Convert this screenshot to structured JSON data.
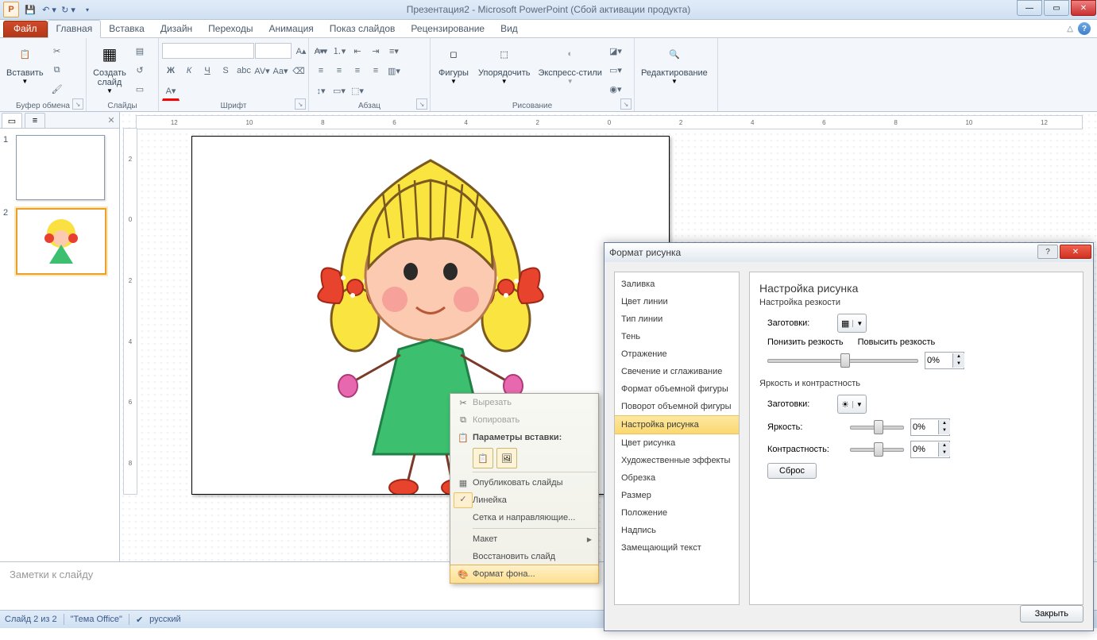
{
  "title": "Презентация2  -  Microsoft PowerPoint (Сбой активации продукта)",
  "tabs": {
    "file": "Файл",
    "list": [
      "Главная",
      "Вставка",
      "Дизайн",
      "Переходы",
      "Анимация",
      "Показ слайдов",
      "Рецензирование",
      "Вид"
    ]
  },
  "groups": {
    "clipboard": {
      "paste": "Вставить",
      "label": "Буфер обмена"
    },
    "slides": {
      "new": "Создать\nслайд",
      "label": "Слайды"
    },
    "font": {
      "label": "Шрифт"
    },
    "para": {
      "label": "Абзац"
    },
    "draw": {
      "shapes": "Фигуры",
      "arrange": "Упорядочить",
      "styles": "Экспресс-стили",
      "label": "Рисование"
    },
    "edit": {
      "btn": "Редактирование"
    }
  },
  "thumbs": [
    "1",
    "2"
  ],
  "ruler": [
    "12",
    "10",
    "8",
    "6",
    "4",
    "2",
    "0",
    "2",
    "4",
    "6",
    "8",
    "10",
    "12"
  ],
  "rulerV": [
    "2",
    "0",
    "2",
    "4",
    "6",
    "8"
  ],
  "notes": "Заметки к слайду",
  "status": {
    "slide": "Слайд 2 из 2",
    "theme": "\"Тема Office\"",
    "lang": "русский"
  },
  "contextMenu": {
    "cut": "Вырезать",
    "copy": "Копировать",
    "pasteOpts": "Параметры вставки:",
    "publish": "Опубликовать слайды",
    "ruler": "Линейка",
    "grid": "Сетка и направляющие...",
    "layout": "Макет",
    "restore": "Восстановить слайд",
    "formatBg": "Формат фона..."
  },
  "dialog": {
    "title": "Формат рисунка",
    "nav": [
      "Заливка",
      "Цвет линии",
      "Тип линии",
      "Тень",
      "Отражение",
      "Свечение и сглаживание",
      "Формат объемной фигуры",
      "Поворот объемной фигуры",
      "Настройка рисунка",
      "Цвет рисунка",
      "Художественные эффекты",
      "Обрезка",
      "Размер",
      "Положение",
      "Надпись",
      "Замещающий текст"
    ],
    "navSel": 8,
    "content": {
      "title": "Настройка рисунка",
      "sharpSection": "Настройка резкости",
      "presets": "Заготовки:",
      "soften": "Понизить резкость",
      "sharpen": "Повысить резкость",
      "sharpVal": "0%",
      "brightSection": "Яркость и контрастность",
      "brightness": "Яркость:",
      "brightVal": "0%",
      "contrast": "Контрастность:",
      "contVal": "0%",
      "reset": "Сброс"
    },
    "close": "Закрыть"
  }
}
